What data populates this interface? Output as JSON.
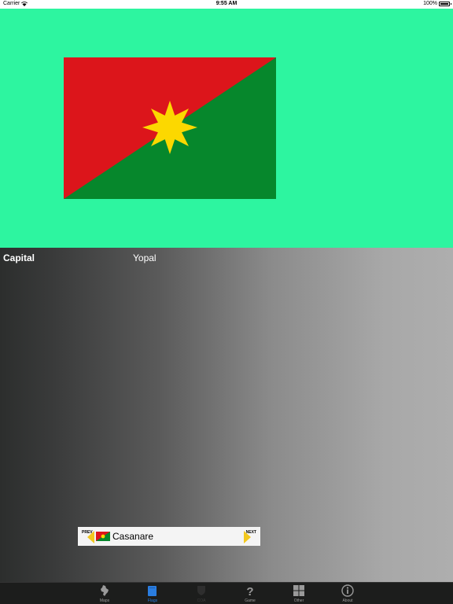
{
  "status_bar": {
    "carrier": "Carrier",
    "time": "9:55 AM",
    "battery": "100%"
  },
  "flag": {
    "colors": {
      "red": "#dc151b",
      "green": "#06872c",
      "star": "#fcd800",
      "background": "#2df5a0"
    }
  },
  "info": {
    "capital_label": "Capital",
    "capital_value": "Yopal"
  },
  "navigator": {
    "prev_label": "PREV",
    "next_label": "NEXT",
    "current_name": "Casanare"
  },
  "tabs": [
    {
      "label": "Maps",
      "icon": "map-icon",
      "active": false
    },
    {
      "label": "Flags",
      "icon": "flag-icon",
      "active": true
    },
    {
      "label": "COA",
      "icon": "coat-of-arms-icon",
      "active": false
    },
    {
      "label": "Game",
      "icon": "question-icon",
      "active": false
    },
    {
      "label": "Other",
      "icon": "grid-icon",
      "active": false
    },
    {
      "label": "About",
      "icon": "info-icon",
      "active": false
    }
  ]
}
